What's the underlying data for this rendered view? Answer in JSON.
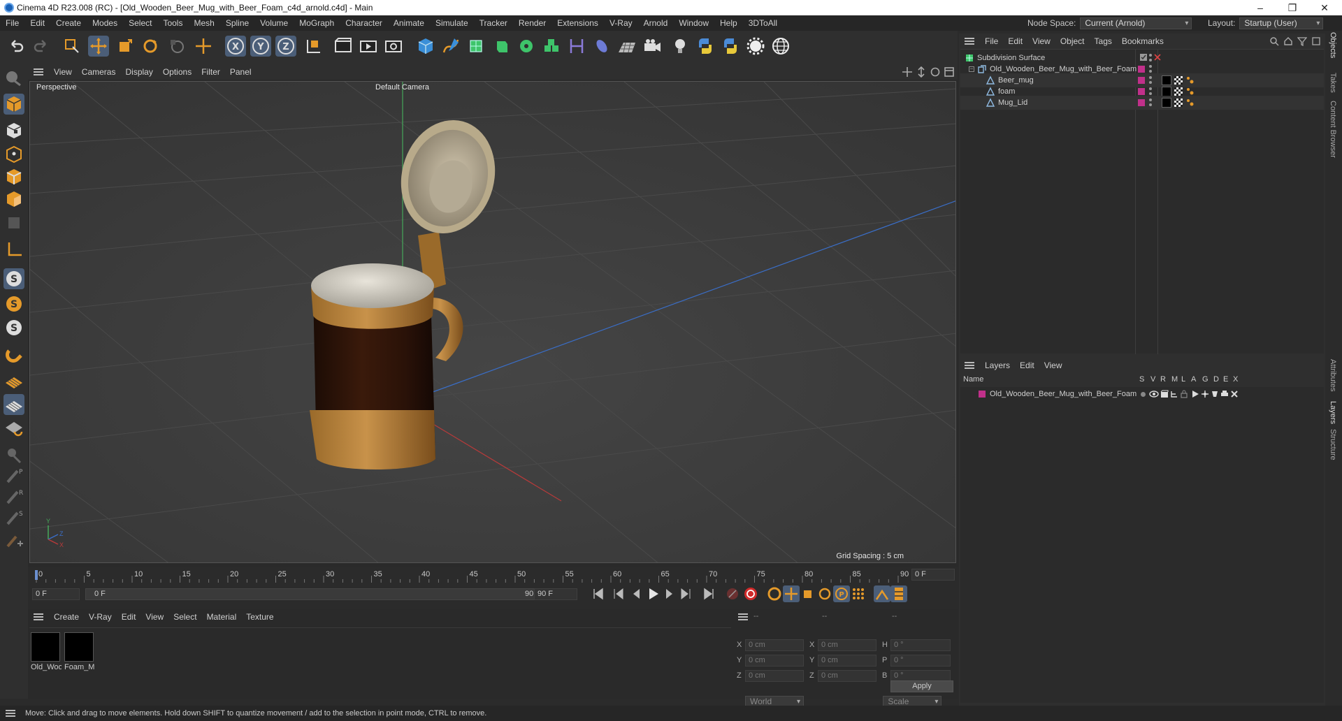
{
  "window": {
    "title": "Cinema 4D R23.008 (RC) - [Old_Wooden_Beer_Mug_with_Beer_Foam_c4d_arnold.c4d] - Main",
    "minimize": "–",
    "maximize": "❐",
    "close": "✕"
  },
  "menu": {
    "items": [
      "File",
      "Edit",
      "Create",
      "Modes",
      "Select",
      "Tools",
      "Mesh",
      "Spline",
      "Volume",
      "MoGraph",
      "Character",
      "Animate",
      "Simulate",
      "Tracker",
      "Render",
      "Extensions",
      "V-Ray",
      "Arnold",
      "Window",
      "Help",
      "3DToAll"
    ],
    "node_space_label": "Node Space:",
    "node_space_value": "Current (Arnold)",
    "layout_label": "Layout:",
    "layout_value": "Startup (User)"
  },
  "viewport": {
    "menu": [
      "View",
      "Cameras",
      "Display",
      "Options",
      "Filter",
      "Panel"
    ],
    "projection": "Perspective",
    "camera": "Default Camera",
    "grid_spacing": "Grid Spacing : 5 cm",
    "axis": {
      "y": "Y",
      "z": "Z",
      "x": "X"
    }
  },
  "timeline": {
    "ticks": [
      "0",
      "5",
      "10",
      "15",
      "20",
      "25",
      "30",
      "35",
      "40",
      "45",
      "50",
      "55",
      "60",
      "65",
      "70",
      "75",
      "80",
      "85",
      "90"
    ],
    "current_frame": "0 F",
    "start_frame": "0 F",
    "range_start": "0 F",
    "range_end": "90 F",
    "end_frame": "90 F"
  },
  "materials": {
    "menu": [
      "Create",
      "V-Ray",
      "Edit",
      "View",
      "Select",
      "Material",
      "Texture"
    ],
    "items": [
      {
        "name": "Old_Woo",
        "color": "#000000"
      },
      {
        "name": "Foam_M",
        "color": "#000000"
      }
    ]
  },
  "coords": {
    "header": [
      "--",
      "--",
      "--"
    ],
    "rows": [
      {
        "l1": "X",
        "v1": "0 cm",
        "l2": "X",
        "v2": "0 cm",
        "l3": "H",
        "v3": "0 °"
      },
      {
        "l1": "Y",
        "v1": "0 cm",
        "l2": "Y",
        "v2": "0 cm",
        "l3": "P",
        "v3": "0 °"
      },
      {
        "l1": "Z",
        "v1": "0 cm",
        "l2": "Z",
        "v2": "0 cm",
        "l3": "B",
        "v3": "0 °"
      }
    ],
    "mode": "World",
    "transform": "Scale",
    "apply": "Apply"
  },
  "objects": {
    "menu": [
      "File",
      "Edit",
      "View",
      "Object",
      "Tags",
      "Bookmarks"
    ],
    "items": [
      {
        "name": "Subdivision Surface",
        "indent": 0,
        "icon": "subdivision-surface-icon"
      },
      {
        "name": "Old_Wooden_Beer_Mug_with_Beer_Foam",
        "indent": 1,
        "icon": "null-object-icon"
      },
      {
        "name": "Beer_mug",
        "indent": 2,
        "icon": "polygon-object-icon"
      },
      {
        "name": "foam",
        "indent": 2,
        "icon": "polygon-object-icon"
      },
      {
        "name": "Mug_Lid",
        "indent": 2,
        "icon": "polygon-object-icon"
      }
    ]
  },
  "layers": {
    "menu": [
      "Layers",
      "Edit",
      "View"
    ],
    "columns": [
      "Name",
      "S",
      "V",
      "R",
      "M",
      "L",
      "A",
      "G",
      "D",
      "E",
      "X"
    ],
    "items": [
      {
        "name": "Old_Wooden_Beer_Mug_with_Beer_Foam",
        "color": "#c0308a"
      }
    ]
  },
  "right_tabs": [
    "Objects",
    "Takes",
    "Content Browser",
    "Attributes",
    "Layers",
    "Structure"
  ],
  "status": "Move: Click and drag to move elements. Hold down SHIFT to quantize movement / add to the selection in point mode, CTRL to remove.",
  "colors": {
    "accent": "#4b5e78",
    "layer_tag": "#c0308a",
    "grid_blue": "#3a6ec8",
    "grid_red": "#b83a3a",
    "grid_green": "#46a85a"
  }
}
